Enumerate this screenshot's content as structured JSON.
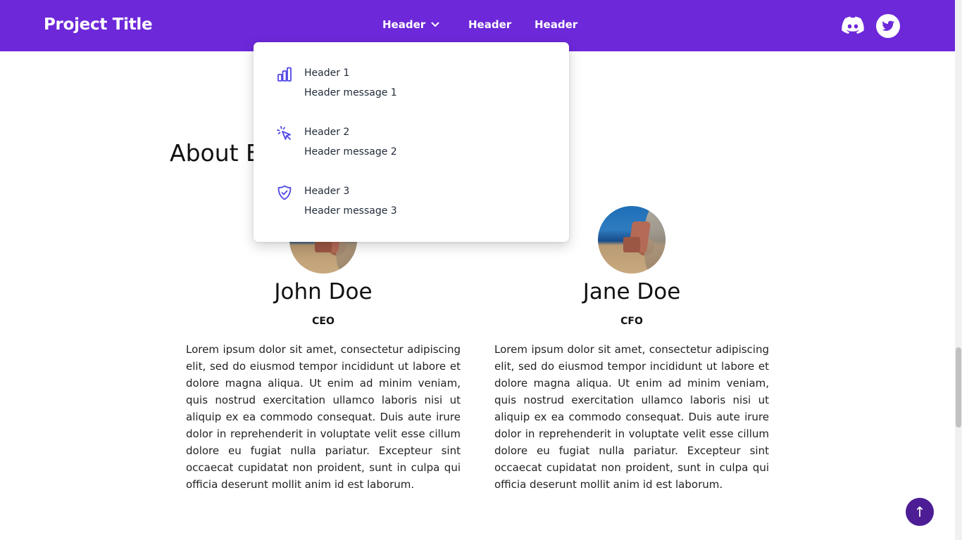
{
  "navbar": {
    "brand": "Project Title",
    "items": [
      {
        "label": "Header",
        "has_dropdown": true
      },
      {
        "label": "Header"
      },
      {
        "label": "Header"
      }
    ],
    "social": [
      "discord-icon",
      "twitter-icon"
    ],
    "background": "#6d28d9"
  },
  "dropdown": {
    "items": [
      {
        "icon": "bar-chart-icon",
        "title": "Header 1",
        "message": "Header message 1"
      },
      {
        "icon": "cursor-click-icon",
        "title": "Header 2",
        "message": "Header message 2"
      },
      {
        "icon": "shield-check-icon",
        "title": "Header 3",
        "message": "Header message 3"
      }
    ],
    "icon_color": "#4f46e5"
  },
  "about": {
    "heading": "About E"
  },
  "team": [
    {
      "name": "John Doe",
      "role": "CEO",
      "bio": "Lorem ipsum dolor sit amet, consectetur adipiscing elit, sed do eiusmod tempor incididunt ut labore et dolore magna aliqua. Ut enim ad minim veniam, quis nostrud exercitation ullamco laboris nisi ut aliquip ex ea commodo consequat. Duis aute irure dolor in reprehenderit in voluptate velit esse cillum dolore eu fugiat nulla pariatur. Excepteur sint occaecat cupidatat non proident, sunt in culpa qui officia deserunt mollit anim id est laborum."
    },
    {
      "name": "Jane Doe",
      "role": "CFO",
      "bio": "Lorem ipsum dolor sit amet, consectetur adipiscing elit, sed do eiusmod tempor incididunt ut labore et dolore magna aliqua. Ut enim ad minim veniam, quis nostrud exercitation ullamco laboris nisi ut aliquip ex ea commodo consequat. Duis aute irure dolor in reprehenderit in voluptate velit esse cillum dolore eu fugiat nulla pariatur. Excepteur sint occaecat cupidatat non proident, sunt in culpa qui officia deserunt mollit anim id est laborum."
    }
  ],
  "back_to_top": {
    "label": "↑",
    "background": "#4c1d95"
  }
}
